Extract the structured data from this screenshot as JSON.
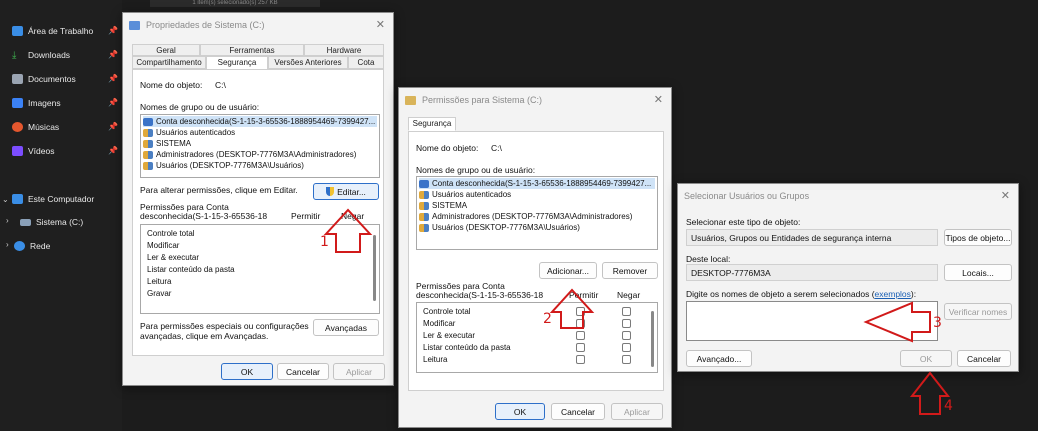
{
  "topstrip": "1 item(s) selecionado(s) 257 KB",
  "sidebar": {
    "items": [
      {
        "label": "Área de Trabalho",
        "icon": "desktop-icon",
        "color": "#3a8ee6"
      },
      {
        "label": "Downloads",
        "icon": "download-icon",
        "color": "#3fb950"
      },
      {
        "label": "Documentos",
        "icon": "document-icon",
        "color": "#9aa4b2"
      },
      {
        "label": "Imagens",
        "icon": "image-icon",
        "color": "#3b82f6"
      },
      {
        "label": "Músicas",
        "icon": "music-icon",
        "color": "#e4572e"
      },
      {
        "label": "Vídeos",
        "icon": "video-icon",
        "color": "#7c4dff"
      }
    ],
    "tree": [
      {
        "label": "Este Computador",
        "icon": "computer-icon"
      },
      {
        "label": "Sistema (C:)",
        "icon": "drive-icon"
      },
      {
        "label": "Rede",
        "icon": "network-icon"
      }
    ]
  },
  "props": {
    "title": "Propriedades de Sistema (C:)",
    "tabs_row1": [
      "Geral",
      "Ferramentas",
      "Hardware"
    ],
    "tabs_row2": [
      "Compartilhamento",
      "Segurança",
      "Versões Anteriores",
      "Cota"
    ],
    "object_label": "Nome do objeto:",
    "object_value": "C:\\",
    "group_label": "Nomes de grupo ou de usuário:",
    "groups": [
      "Conta desconhecida(S-1-15-3-65536-1888954469-7399427...",
      "Usuários autenticados",
      "SISTEMA",
      "Administradores (DESKTOP-7776M3A\\Administradores)",
      "Usuários (DESKTOP-7776M3A\\Usuários)"
    ],
    "change_text": "Para alterar permissões, clique em Editar.",
    "edit_button": "Editar...",
    "perm_title_1": "Permissões para Conta",
    "perm_title_2": "desconhecida(S-1-15-3-65536-18",
    "allow": "Permitir",
    "deny": "Negar",
    "permissions": [
      "Controle total",
      "Modificar",
      "Ler & executar",
      "Listar conteúdo da pasta",
      "Leitura",
      "Gravar"
    ],
    "special_text_1": "Para permissões especiais ou configurações",
    "special_text_2": "avançadas, clique em Avançadas.",
    "advanced_button": "Avançadas",
    "ok": "OK",
    "cancel": "Cancelar",
    "apply": "Aplicar"
  },
  "perms": {
    "title": "Permissões para Sistema (C:)",
    "tab": "Segurança",
    "object_label": "Nome do objeto:",
    "object_value": "C:\\",
    "group_label": "Nomes de grupo ou de usuário:",
    "groups": [
      "Conta desconhecida(S-1-15-3-65536-1888954469-7399427...",
      "Usuários autenticados",
      "SISTEMA",
      "Administradores (DESKTOP-7776M3A\\Administradores)",
      "Usuários (DESKTOP-7776M3A\\Usuários)"
    ],
    "add_button": "Adicionar...",
    "remove_button": "Remover",
    "perm_title_1": "Permissões para Conta",
    "perm_title_2": "desconhecida(S-1-15-3-65536-18",
    "allow": "Permitir",
    "deny": "Negar",
    "permissions": [
      "Controle total",
      "Modificar",
      "Ler & executar",
      "Listar conteúdo da pasta",
      "Leitura"
    ],
    "ok": "OK",
    "cancel": "Cancelar",
    "apply": "Aplicar"
  },
  "select": {
    "title": "Selecionar Usuários ou Grupos",
    "type_label": "Selecionar este tipo de objeto:",
    "type_value": "Usuários, Grupos ou Entidades de segurança interna",
    "type_button": "Tipos de objeto...",
    "location_label": "Deste local:",
    "location_value": "DESKTOP-7776M3A",
    "location_button": "Locais...",
    "names_label_prefix": "Digite os nomes de objeto a serem selecionados (",
    "names_label_link": "exemplos",
    "names_label_suffix": "):",
    "verify_button": "Verificar nomes",
    "advanced_button": "Avançado...",
    "ok": "OK",
    "cancel": "Cancelar"
  },
  "annotations": [
    "1",
    "2",
    "3",
    "4"
  ],
  "colors": {
    "annotation": "#d11a1a",
    "accent": "#2d6fc9"
  }
}
